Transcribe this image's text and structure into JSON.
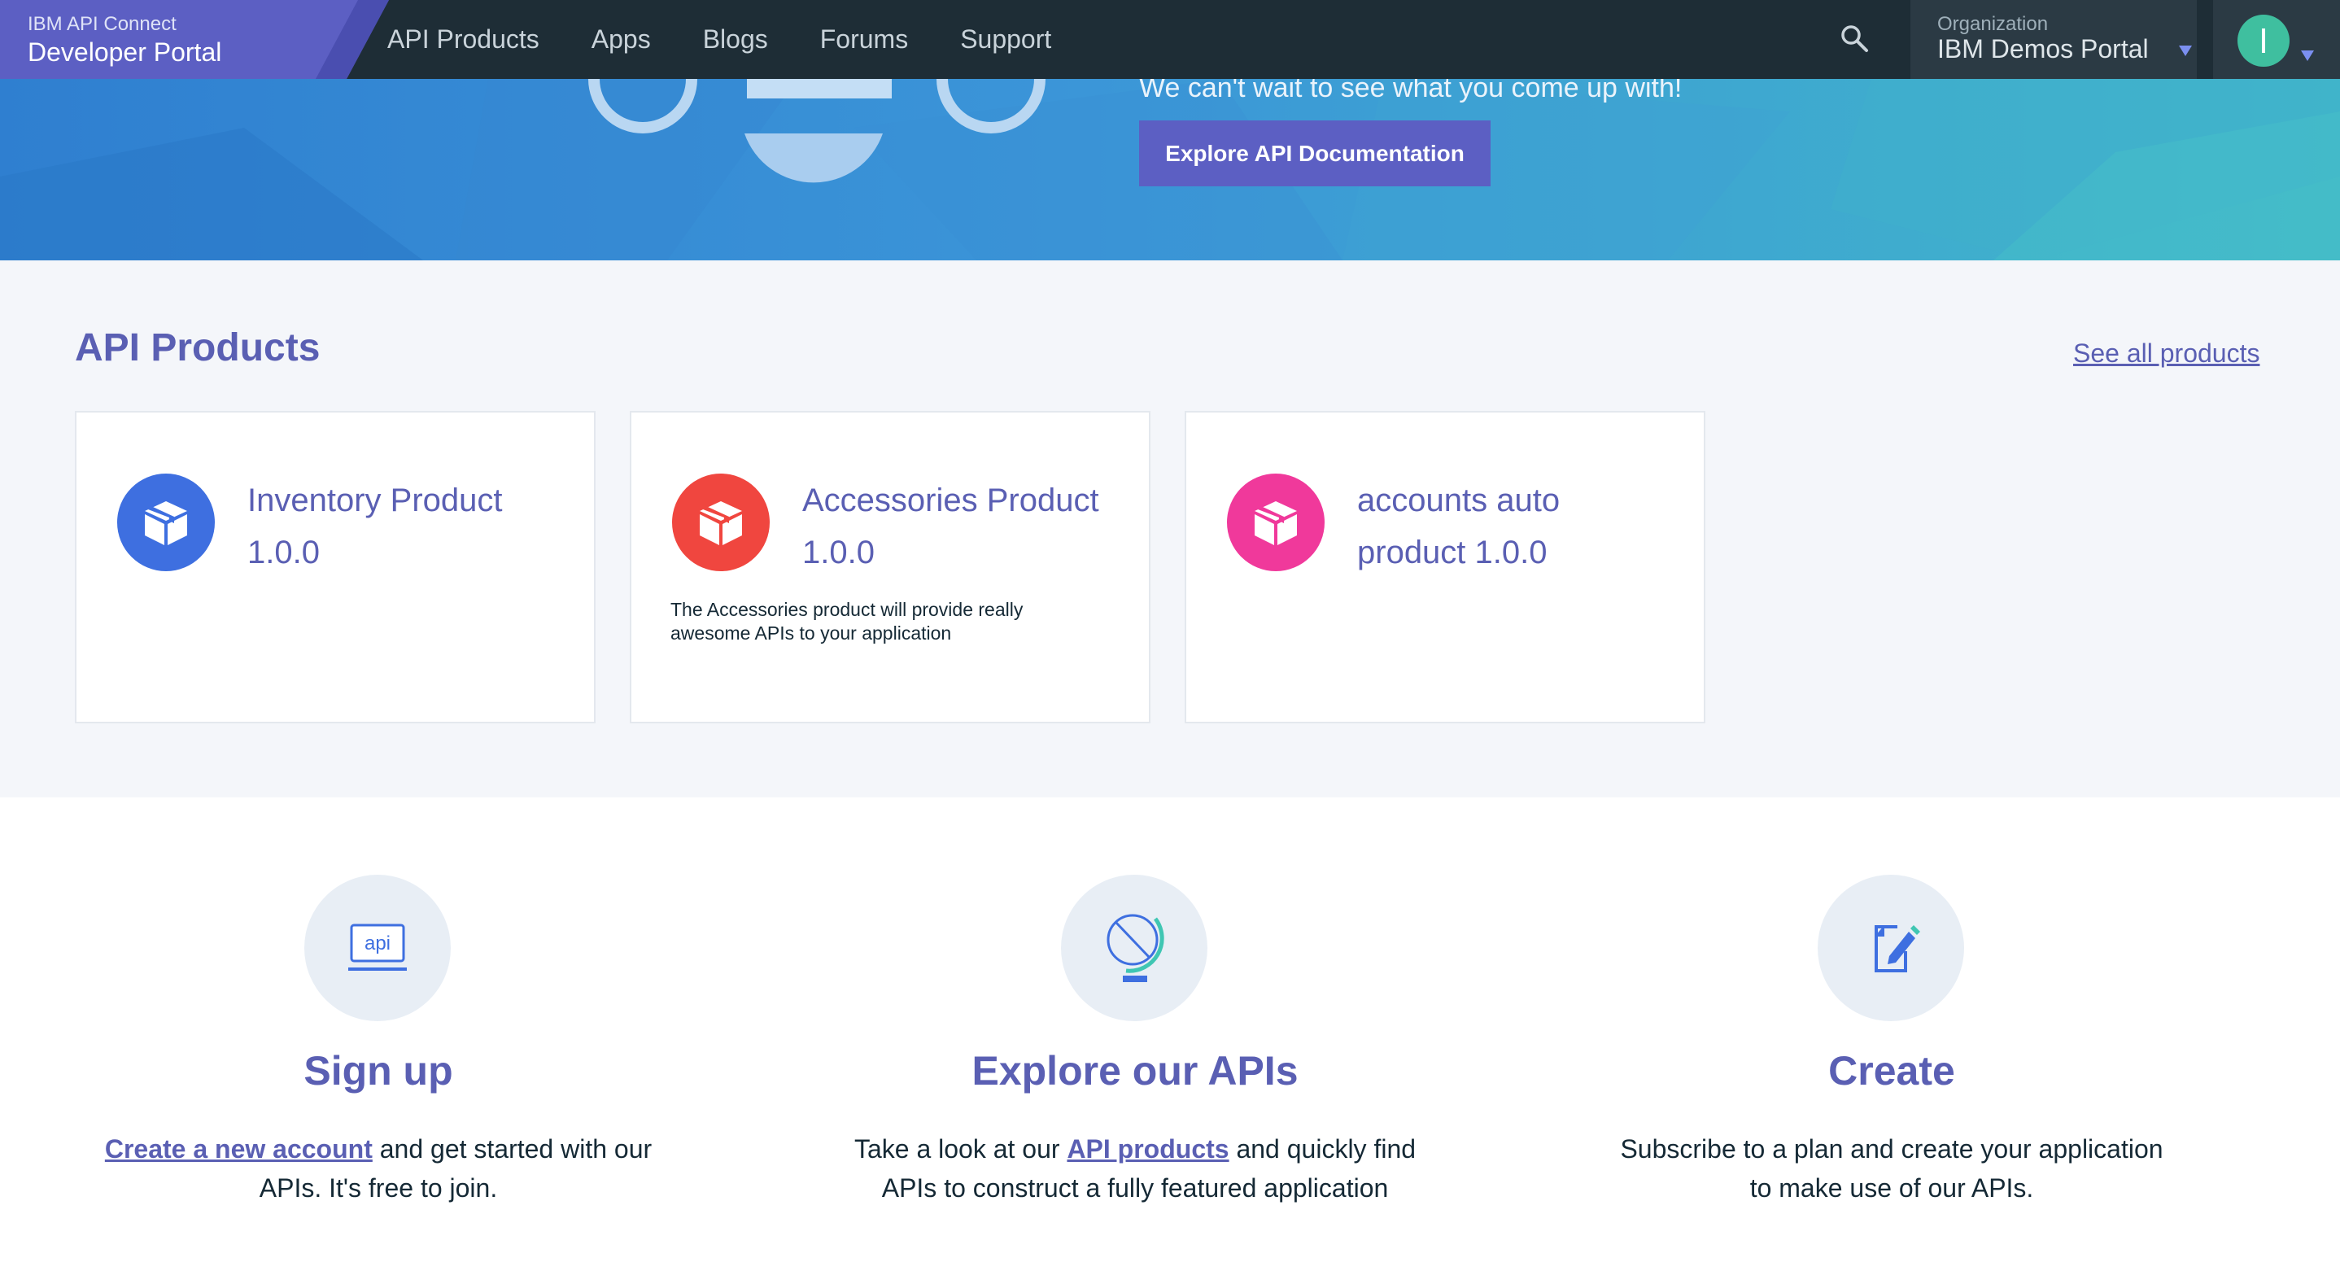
{
  "brand": {
    "subtitle": "IBM API Connect",
    "title": "Developer Portal"
  },
  "nav": {
    "items": [
      {
        "label": "API Products"
      },
      {
        "label": "Apps"
      },
      {
        "label": "Blogs"
      },
      {
        "label": "Forums"
      },
      {
        "label": "Support"
      }
    ],
    "search_icon": "search-icon"
  },
  "organization": {
    "label": "Organization",
    "value": "IBM Demos Portal"
  },
  "user": {
    "avatar_initial": "I"
  },
  "hero": {
    "text": "We can't wait to see what you come up with!",
    "button_label": "Explore API Documentation"
  },
  "products_section": {
    "title": "API Products",
    "see_all_label": "See all products",
    "cards": [
      {
        "name": "Inventory Product 1.0.0",
        "name_line1": "Inventory Product",
        "name_line2": "1.0.0",
        "description": "",
        "icon": "package-icon",
        "color": "#3e6fe0"
      },
      {
        "name": "Accessories Product 1.0.0",
        "name_line1": "Accessories Product",
        "name_line2": "1.0.0",
        "description_line1": "The Accessories product will provide really",
        "description_line2": "awesome APIs to your application",
        "icon": "package-icon",
        "color": "#f0463f"
      },
      {
        "name": "accounts auto product 1.0.0",
        "name_line1": "accounts auto",
        "name_line2": "product 1.0.0",
        "description": "",
        "icon": "package-icon",
        "color": "#f0399b"
      }
    ]
  },
  "features": [
    {
      "title": "Sign up",
      "icon": "api-icon",
      "icon_text": "api",
      "link_label": "Create a new account",
      "text_after_link": " and get started with our",
      "line2": "APIs. It's free to join."
    },
    {
      "title": "Explore our APIs",
      "icon": "globe-icon",
      "text_before_link": "Take a look at our ",
      "link_label": "API products",
      "text_after_link": " and quickly find",
      "line2": "APIs to construct a fully featured application"
    },
    {
      "title": "Create",
      "icon": "edit-document-icon",
      "line1": "Subscribe to a plan and create your application",
      "line2": "to make use of our APIs."
    }
  ],
  "colors": {
    "accent": "#5a5fb3",
    "nav_bg": "#1e2d36",
    "button": "#5c5fc3"
  }
}
